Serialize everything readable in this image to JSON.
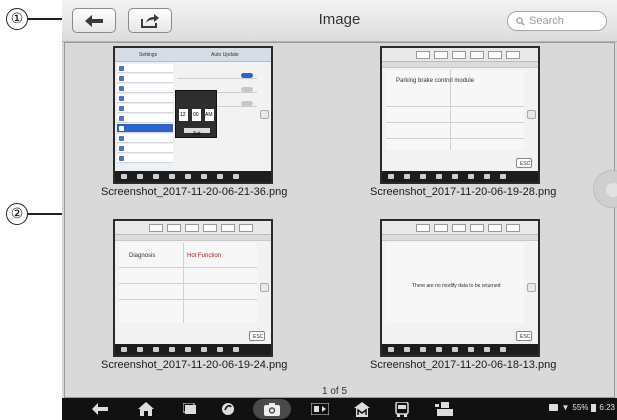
{
  "callouts": {
    "one": "①",
    "two": "②"
  },
  "header": {
    "title": "Image",
    "search_placeholder": "Search"
  },
  "gallery": {
    "items": [
      {
        "caption": "Screenshot_2017-11-20-06-21-36.png"
      },
      {
        "caption": "Screenshot_2017-11-20-06-19-28.png",
        "body_text": "Parking brake control module",
        "button": "ESC"
      },
      {
        "caption": "Screenshot_2017-11-20-06-19-24.png",
        "col1": "Diagnosis",
        "col2": "Hot Function",
        "button": "ESC"
      },
      {
        "caption": "Screenshot_2017-11-20-06-18-13.png",
        "message": "There are no modify data to be returned",
        "button": "ESC"
      }
    ]
  },
  "settings_thumb": {
    "left_header": "Settings",
    "right_header": "Auto Update",
    "dialog_hour": "12",
    "dialog_min": "00",
    "dialog_ampm": "AM",
    "dialog_button": "Set"
  },
  "pager": {
    "label": "1 of 5"
  },
  "status_bar": {
    "battery": "55%",
    "time": "6:23"
  },
  "colors": {
    "accent": "#2f63c6",
    "nav_bg": "#111111",
    "red_text": "#b0181b"
  }
}
